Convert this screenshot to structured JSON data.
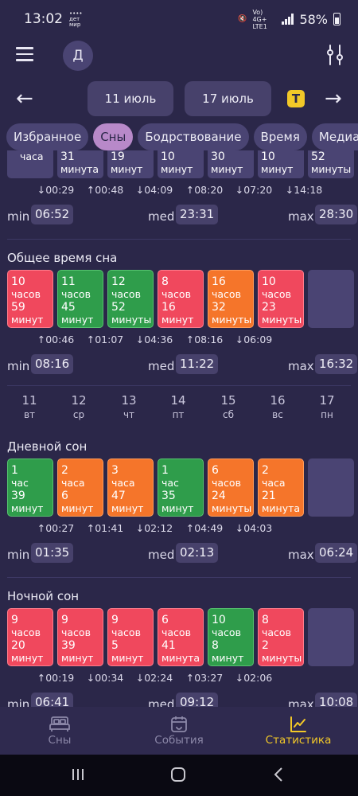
{
  "status": {
    "time": "13:02",
    "net": "•••• дет мир",
    "lte": "Vo) 4G+ LTE1",
    "battery": "58%"
  },
  "header": {
    "avatar_letter": "Д"
  },
  "daterange": {
    "start": "11 июль",
    "end": "17 июль",
    "badge": "T"
  },
  "tabs": [
    {
      "label": "Избранное",
      "active": false
    },
    {
      "label": "Сны",
      "active": true
    },
    {
      "label": "Бодрствование",
      "active": false
    },
    {
      "label": "Время",
      "active": false
    },
    {
      "label": "Медианы",
      "active": false
    }
  ],
  "top_partial": {
    "cells": [
      {
        "l1": "",
        "l2": "часа"
      },
      {
        "l1": "31",
        "l2": "минута"
      },
      {
        "l1": "19",
        "l2": "минут"
      },
      {
        "l1": "10",
        "l2": "минут"
      },
      {
        "l1": "30",
        "l2": "минут"
      },
      {
        "l1": "10",
        "l2": "минут"
      },
      {
        "l1": "52",
        "l2": "минуты"
      }
    ],
    "deltas": [
      "↓00:29",
      "↑00:48",
      "↓04:09",
      "↑08:20",
      "↓07:20",
      "↓14:18"
    ],
    "min_label": "min:",
    "min": "06:52",
    "med_label": "med:",
    "med": "23:31",
    "max_label": "max:",
    "max": "28:30"
  },
  "total": {
    "title": "Общее время сна",
    "cells": [
      {
        "h": "10",
        "hu": "часов",
        "m": "59",
        "mu": "минут",
        "color": "red"
      },
      {
        "h": "11",
        "hu": "часов",
        "m": "45",
        "mu": "минут",
        "color": "green"
      },
      {
        "h": "12",
        "hu": "часов",
        "m": "52",
        "mu": "минуты",
        "color": "green"
      },
      {
        "h": "8",
        "hu": "часов",
        "m": "16",
        "mu": "минут",
        "color": "red"
      },
      {
        "h": "16",
        "hu": "часов",
        "m": "32",
        "mu": "минуты",
        "color": "orange"
      },
      {
        "h": "10",
        "hu": "часов",
        "m": "23",
        "mu": "минуты",
        "color": "red"
      }
    ],
    "deltas": [
      "↑00:46",
      "↑01:07",
      "↓04:36",
      "↑08:16",
      "↓06:09"
    ],
    "min_label": "min:",
    "min": "08:16",
    "med_label": "med:",
    "med": "11:22",
    "max_label": "max:",
    "max": "16:32"
  },
  "days": [
    {
      "d": "11",
      "w": "вт"
    },
    {
      "d": "12",
      "w": "ср"
    },
    {
      "d": "13",
      "w": "чт"
    },
    {
      "d": "14",
      "w": "пт"
    },
    {
      "d": "15",
      "w": "сб"
    },
    {
      "d": "16",
      "w": "вс"
    },
    {
      "d": "17",
      "w": "пн"
    }
  ],
  "day_sleep": {
    "title": "Дневной сон",
    "cells": [
      {
        "h": "1",
        "hu": "час",
        "m": "39",
        "mu": "минут",
        "color": "green"
      },
      {
        "h": "2",
        "hu": "часа",
        "m": "6",
        "mu": "минут",
        "color": "orange"
      },
      {
        "h": "3",
        "hu": "часа",
        "m": "47",
        "mu": "минут",
        "color": "orange"
      },
      {
        "h": "1",
        "hu": "час",
        "m": "35",
        "mu": "минут",
        "color": "green"
      },
      {
        "h": "6",
        "hu": "часов",
        "m": "24",
        "mu": "минуты",
        "color": "orange"
      },
      {
        "h": "2",
        "hu": "часа",
        "m": "21",
        "mu": "минута",
        "color": "orange"
      }
    ],
    "deltas": [
      "↑00:27",
      "↑01:41",
      "↓02:12",
      "↑04:49",
      "↓04:03"
    ],
    "min_label": "min:",
    "min": "01:35",
    "med_label": "med:",
    "med": "02:13",
    "max_label": "max:",
    "max": "06:24"
  },
  "night_sleep": {
    "title": "Ночной сон",
    "cells": [
      {
        "h": "9",
        "hu": "часов",
        "m": "20",
        "mu": "минут",
        "color": "red"
      },
      {
        "h": "9",
        "hu": "часов",
        "m": "39",
        "mu": "минут",
        "color": "red"
      },
      {
        "h": "9",
        "hu": "часов",
        "m": "5",
        "mu": "минут",
        "color": "red"
      },
      {
        "h": "6",
        "hu": "часов",
        "m": "41",
        "mu": "минута",
        "color": "red"
      },
      {
        "h": "10",
        "hu": "часов",
        "m": "8",
        "mu": "минут",
        "color": "green"
      },
      {
        "h": "8",
        "hu": "часов",
        "m": "2",
        "mu": "минуты",
        "color": "red"
      }
    ],
    "deltas": [
      "↑00:19",
      "↓00:34",
      "↓02:24",
      "↑03:27",
      "↓02:06"
    ],
    "min_label": "min:",
    "min": "06:41",
    "med_label": "med:",
    "med": "09:12",
    "max_label": "max:",
    "max": "10:08"
  },
  "nav": [
    {
      "label": "Сны",
      "icon": "bed-icon",
      "active": false
    },
    {
      "label": "События",
      "icon": "calendar-icon",
      "active": false
    },
    {
      "label": "Статистика",
      "icon": "chart-icon",
      "active": true
    }
  ],
  "colors": {
    "background": "#2b2749",
    "accent": "#f2c828",
    "chip_active": "#b889c9",
    "red": "#f0485d",
    "green": "#2f9d4b",
    "orange": "#f5752a"
  }
}
